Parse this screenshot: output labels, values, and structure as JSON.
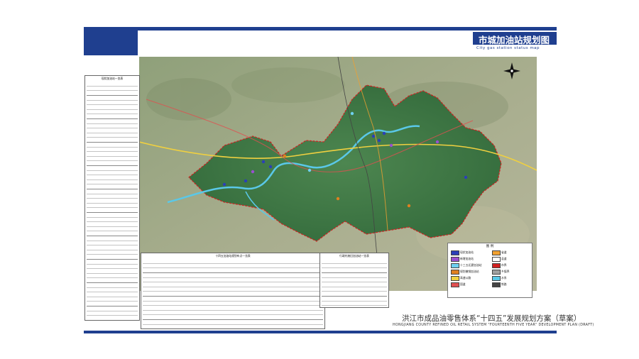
{
  "header": {
    "title": "市城加油站规划图",
    "subtitle": "City gas station status map"
  },
  "footer": {
    "title_cn": "洪江市成品油零售体系“十四五”发展规划方案（草案）",
    "title_en": "HONGJIANG COUNTY REFINED OIL RETAIL SYSTEM \"FOURTEENTH FIVE YEAR\" DEVELOPMENT PLAN (DRAFT)"
  },
  "legend": {
    "title": "图 例",
    "items": [
      {
        "label": "现状加油站",
        "color": "#2b3fb8"
      },
      {
        "label": "新增加油站",
        "color": "#9a4fd0"
      },
      {
        "label": "十三五迁建加油站",
        "color": "#6fd0f0"
      },
      {
        "label": "规划撤销加油站",
        "color": "#e08020"
      },
      {
        "label": "高速公路",
        "color": "#f0d040"
      },
      {
        "label": "国道",
        "color": "#e05050"
      },
      {
        "label": "省道",
        "color": "#f0a030"
      },
      {
        "label": "县道",
        "color": "#ffffff"
      },
      {
        "label": "市界",
        "color": "#d02020"
      },
      {
        "label": "乡镇界",
        "color": "#a0a0a0"
      },
      {
        "label": "水系",
        "color": "#5ac8e8"
      },
      {
        "label": "铁路",
        "color": "#444444"
      }
    ]
  },
  "tables": {
    "left_title": "现状加油站一览表",
    "mid_title": "十四五加油站规划布点一览表",
    "right_title": "行政村废旧加油站一览表"
  },
  "colors": {
    "brand": "#1f3f8f",
    "region": "#3f7a45",
    "river": "#5ac8e8"
  }
}
